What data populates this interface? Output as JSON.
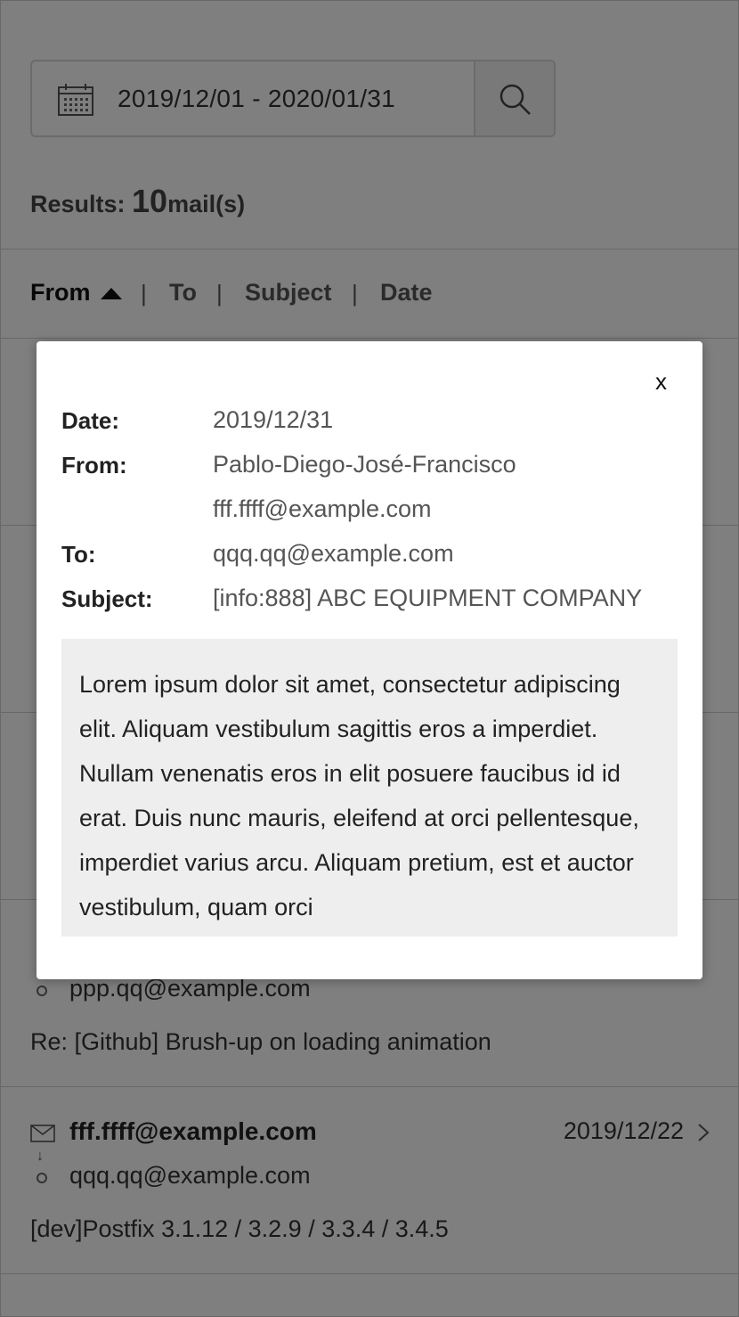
{
  "search": {
    "date_range": "2019/12/01 - 2020/01/31"
  },
  "results": {
    "label": "Results: ",
    "count": "10",
    "unit": "mail(s)"
  },
  "sort": {
    "from": "From",
    "to": "To",
    "subject": "Subject",
    "date": "Date",
    "separator": "|"
  },
  "mails": [
    {
      "from": "",
      "to": "ppp.qq@example.com",
      "subject": "Re: [Github] Brush-up on loading animation",
      "date": ""
    },
    {
      "from": "fff.ffff@example.com",
      "to": "qqq.qq@example.com",
      "subject": "[dev]Postfix 3.1.12 / 3.2.9 / 3.3.4 / 3.4.5",
      "date": "2019/12/22"
    }
  ],
  "modal": {
    "close": "x",
    "date_label": "Date:",
    "date_value": "2019/12/31",
    "from_label": "From:",
    "from_name": "Pablo-Diego-José-Francisco",
    "from_email": "fff.ffff@example.com",
    "to_label": "To:",
    "to_value": "qqq.qq@example.com",
    "subject_label": "Subject:",
    "subject_value": "[info:888] ABC EQUIPMENT COMPANY",
    "body": "Lorem ipsum dolor sit amet, consectetur adipiscing elit. Aliquam vestibulum sagittis eros a imperdiet. Nullam venenatis eros in elit posuere faucibus id id erat. Duis nunc mauris, eleifend at orci pellentesque, imperdiet varius arcu. Aliquam pretium, est et auctor vestibulum, quam orci"
  },
  "colors": {
    "overlay": "rgba(0,0,0,0.5)",
    "modal_bg": "#ffffff",
    "body_bg": "#eeeeee"
  }
}
